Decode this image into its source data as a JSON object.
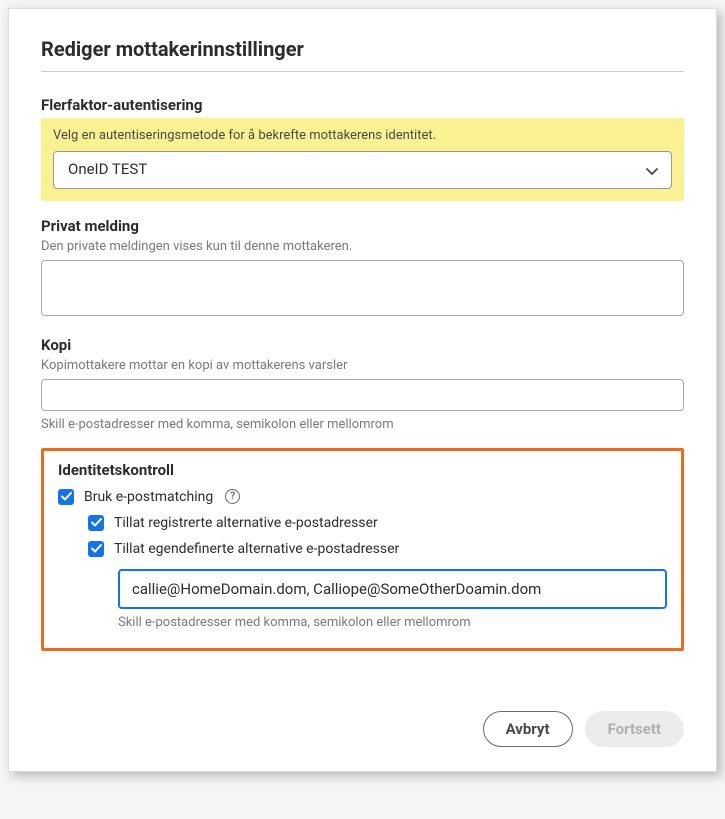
{
  "dialog": {
    "title": "Rediger mottakerinnstillinger"
  },
  "mfa": {
    "section_title": "Flerfaktor-autentisering",
    "helper": "Velg en autentiseringsmetode for å bekrefte mottakerens identitet.",
    "selected": "OneID TEST"
  },
  "private_message": {
    "section_title": "Privat melding",
    "helper": "Den private meldingen vises kun til denne mottakeren.",
    "value": ""
  },
  "copy": {
    "section_title": "Kopi",
    "helper": "Kopimottakere mottar en kopi av mottakerens varsler",
    "value": "",
    "hint": "Skill e-postadresser med komma, semikolon eller mellomrom"
  },
  "identity": {
    "section_title": "Identitetskontroll",
    "email_matching_label": "Bruk e-postmatching",
    "registered_alt_label": "Tillat registrerte alternative e-postadresser",
    "custom_alt_label": "Tillat egendefinerte alternative e-postadresser",
    "email_value": "callie@HomeDomain.dom, Calliope@SomeOtherDoamin.dom",
    "email_hint": "Skill e-postadresser med komma, semikolon eller mellomrom"
  },
  "footer": {
    "cancel": "Avbryt",
    "continue": "Fortsett"
  }
}
